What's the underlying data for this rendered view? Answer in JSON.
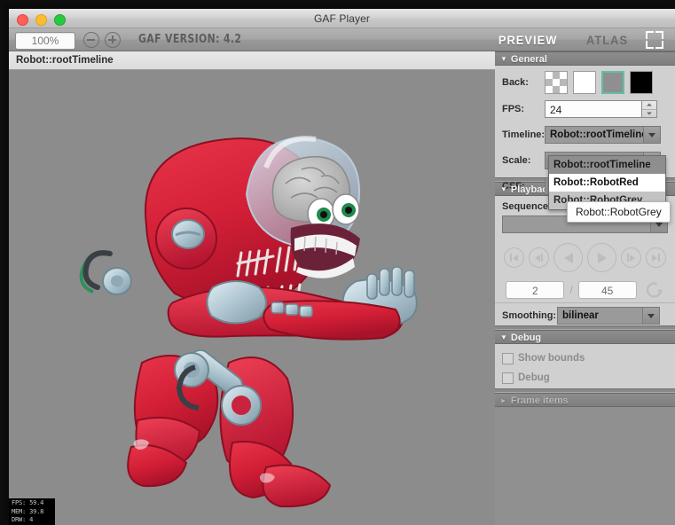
{
  "window": {
    "title": "GAF Player",
    "traffic_lights": [
      "close",
      "minimize",
      "maximize"
    ]
  },
  "toolbar": {
    "zoom_value": "100%",
    "zoom_out_label": "−",
    "zoom_in_label": "+",
    "version_text": "GAF VERSION: 4.2",
    "tab_preview": "PREVIEW",
    "tab_atlas": "ATLAS",
    "active_tab": "PREVIEW"
  },
  "breadcrumb": {
    "path": "Robot::rootTimeline"
  },
  "stage": {
    "background_color": "#8c8c8c",
    "stats": {
      "fps": "FPS: 59.4",
      "mem": "MEM: 39.8",
      "drw": "DRW: 4"
    }
  },
  "inspector": {
    "general": {
      "header": "General",
      "back_label": "Back:",
      "swatches": [
        {
          "name": "checker",
          "color": "transparent",
          "selected": false
        },
        {
          "name": "white",
          "color": "#ffffff",
          "selected": false
        },
        {
          "name": "gray",
          "color": "#8f8f8f",
          "selected": true
        },
        {
          "name": "black",
          "color": "#000000",
          "selected": false
        }
      ],
      "selection_color": "#5fbfa8",
      "fps_label": "FPS:",
      "fps_value": "24",
      "timeline_label": "Timeline:",
      "timeline_value": "Robot::rootTimeline",
      "scale_label": "Scale:",
      "csf_label": "CSF:"
    },
    "timeline_dropdown": {
      "open": true,
      "options": [
        {
          "label": "Robot::rootTimeline",
          "state": "selected"
        },
        {
          "label": "Robot::RobotRed",
          "state": "highlighted"
        },
        {
          "label": "Robot::RobotGrey",
          "state": "normal"
        }
      ],
      "tooltip": "Robot::RobotGrey"
    },
    "playback": {
      "header": "Playback",
      "sequence_label": "Sequence:",
      "sequence_value": "",
      "transport": [
        {
          "name": "first-frame",
          "size": "sm"
        },
        {
          "name": "step-back",
          "size": "sm"
        },
        {
          "name": "play-reverse",
          "size": "lg"
        },
        {
          "name": "play-forward",
          "size": "lg"
        },
        {
          "name": "step-forward",
          "size": "sm"
        },
        {
          "name": "last-frame",
          "size": "sm"
        }
      ],
      "current_frame": "2",
      "separator": "/",
      "total_frames": "45",
      "loop_icon": "loop-icon",
      "smoothing_label": "Smoothing:",
      "smoothing_value": "bilinear"
    },
    "debug": {
      "header": "Debug",
      "show_bounds_label": "Show bounds",
      "show_bounds_checked": false,
      "debug_label": "Debug",
      "debug_checked": false
    },
    "frame_items": {
      "header": "Frame items",
      "collapsed": true
    }
  }
}
